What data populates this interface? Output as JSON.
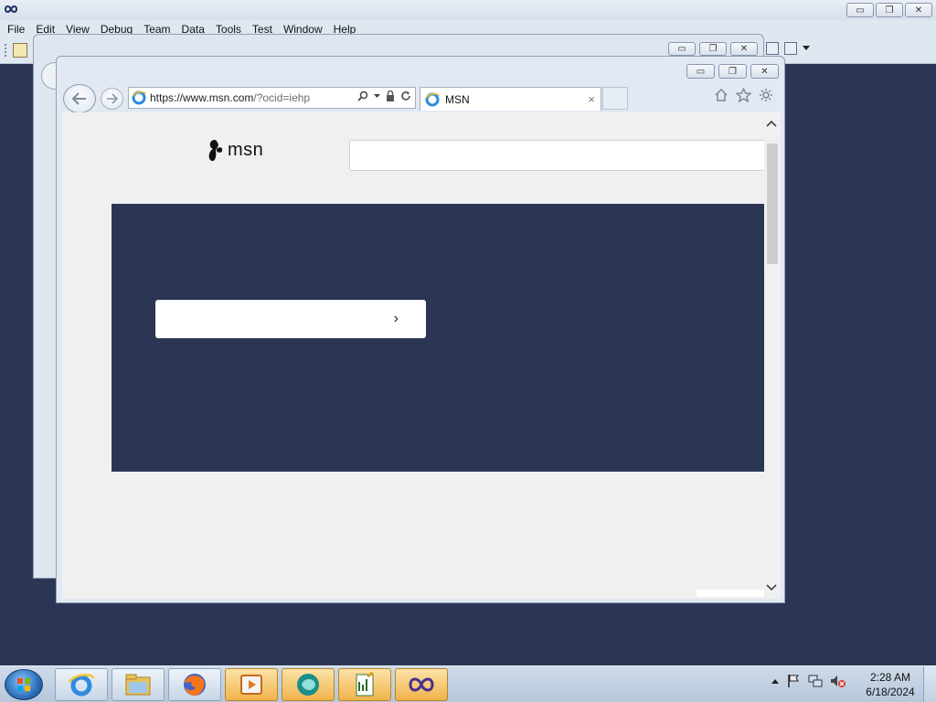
{
  "vs": {
    "menu": [
      "File",
      "Edit",
      "View",
      "Debug",
      "Team",
      "Data",
      "Tools",
      "Test",
      "Window",
      "Help"
    ],
    "caption": {
      "minimize": "▭",
      "restore": "❐",
      "close": "✕"
    }
  },
  "browser": {
    "url_host": "https://www.msn.com",
    "url_path": "/?ocid=iehp",
    "tab_title": "MSN",
    "tab_close": "×",
    "caption": {
      "minimize": "▭",
      "restore": "❐",
      "close": "✕"
    }
  },
  "page": {
    "logo_text": "msn",
    "hero_chevron": "›",
    "hero_bg": "#2b3655"
  },
  "taskbar": {
    "time": "2:28 AM",
    "date": "6/18/2024",
    "apps": [
      "internet-explorer",
      "file-explorer",
      "firefox",
      "media-player",
      "app-circle",
      "notepad-chart",
      "visual-studio"
    ]
  }
}
